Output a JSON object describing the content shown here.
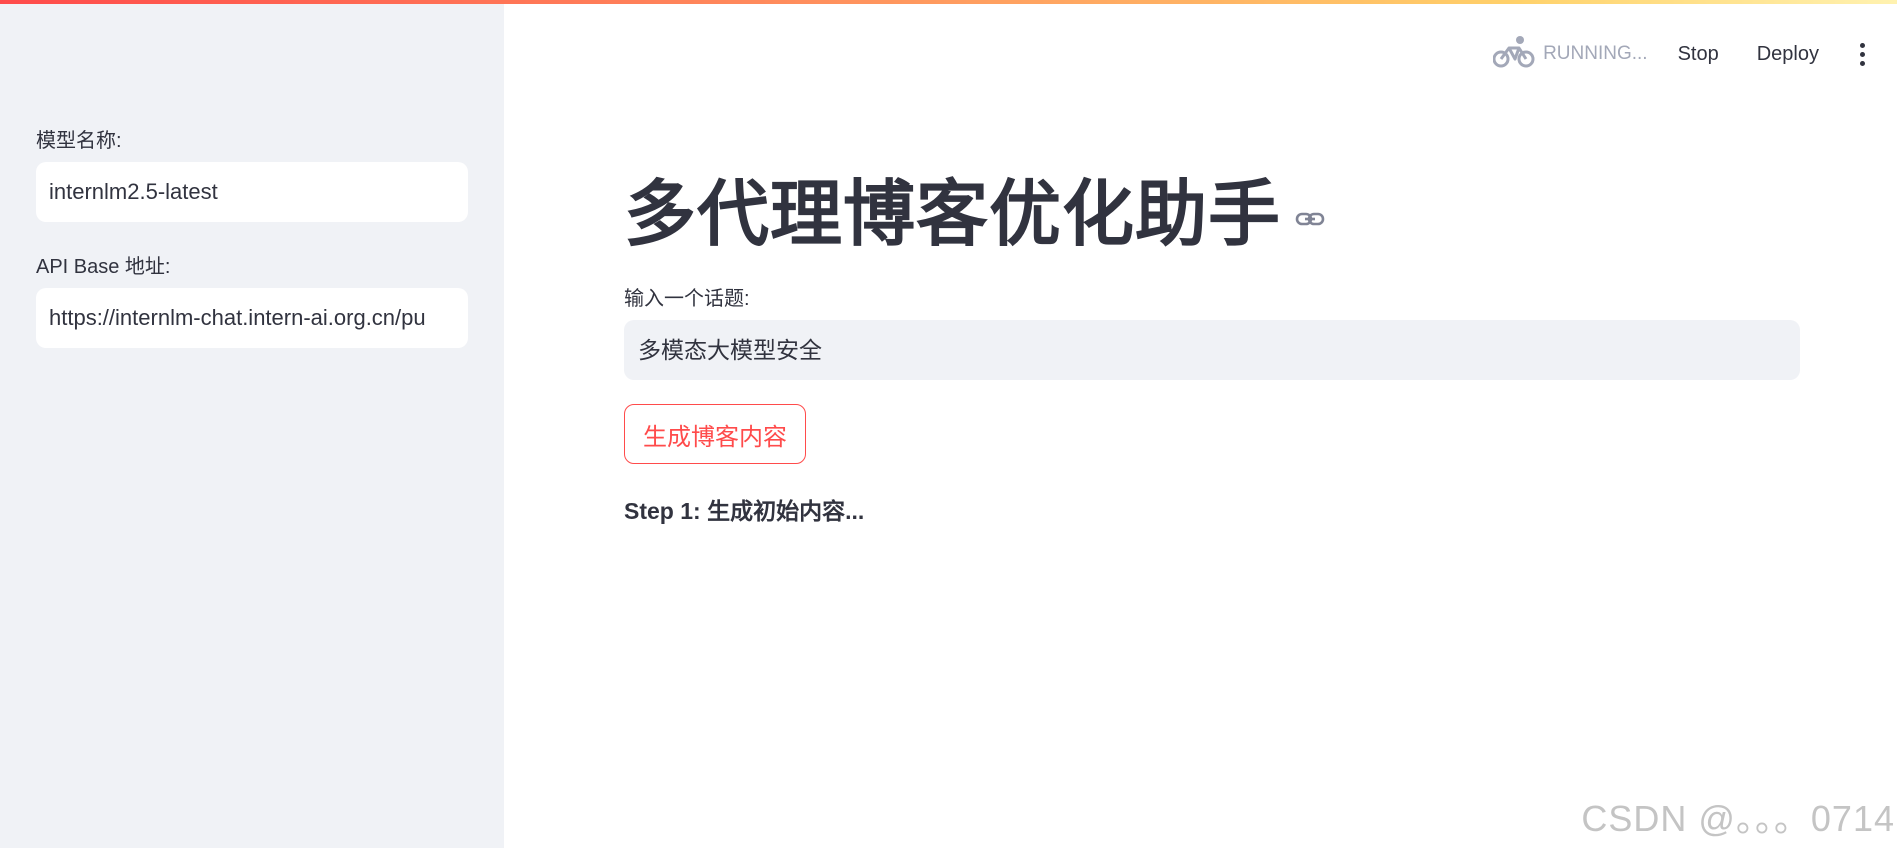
{
  "sidebar": {
    "model_label": "模型名称:",
    "model_value": "internlm2.5-latest",
    "api_label": "API Base 地址:",
    "api_value": "https://internlm-chat.intern-ai.org.cn/pu"
  },
  "header": {
    "status": "RUNNING...",
    "stop_label": "Stop",
    "deploy_label": "Deploy",
    "menu_icon": "vertical-dots-icon",
    "status_icon": "bicycle-icon"
  },
  "main": {
    "title": "多代理博客优化助手",
    "topic_label": "输入一个话题:",
    "topic_value": "多模态大模型安全",
    "button_label": "生成博客内容",
    "step_text": "Step 1: 生成初始内容..."
  },
  "watermark": "CSDN @。。。0714",
  "colors": {
    "accent": "#ff4b4b",
    "sidebar_bg": "#f0f2f6",
    "text": "#31333f",
    "muted": "#a3a8b8"
  }
}
